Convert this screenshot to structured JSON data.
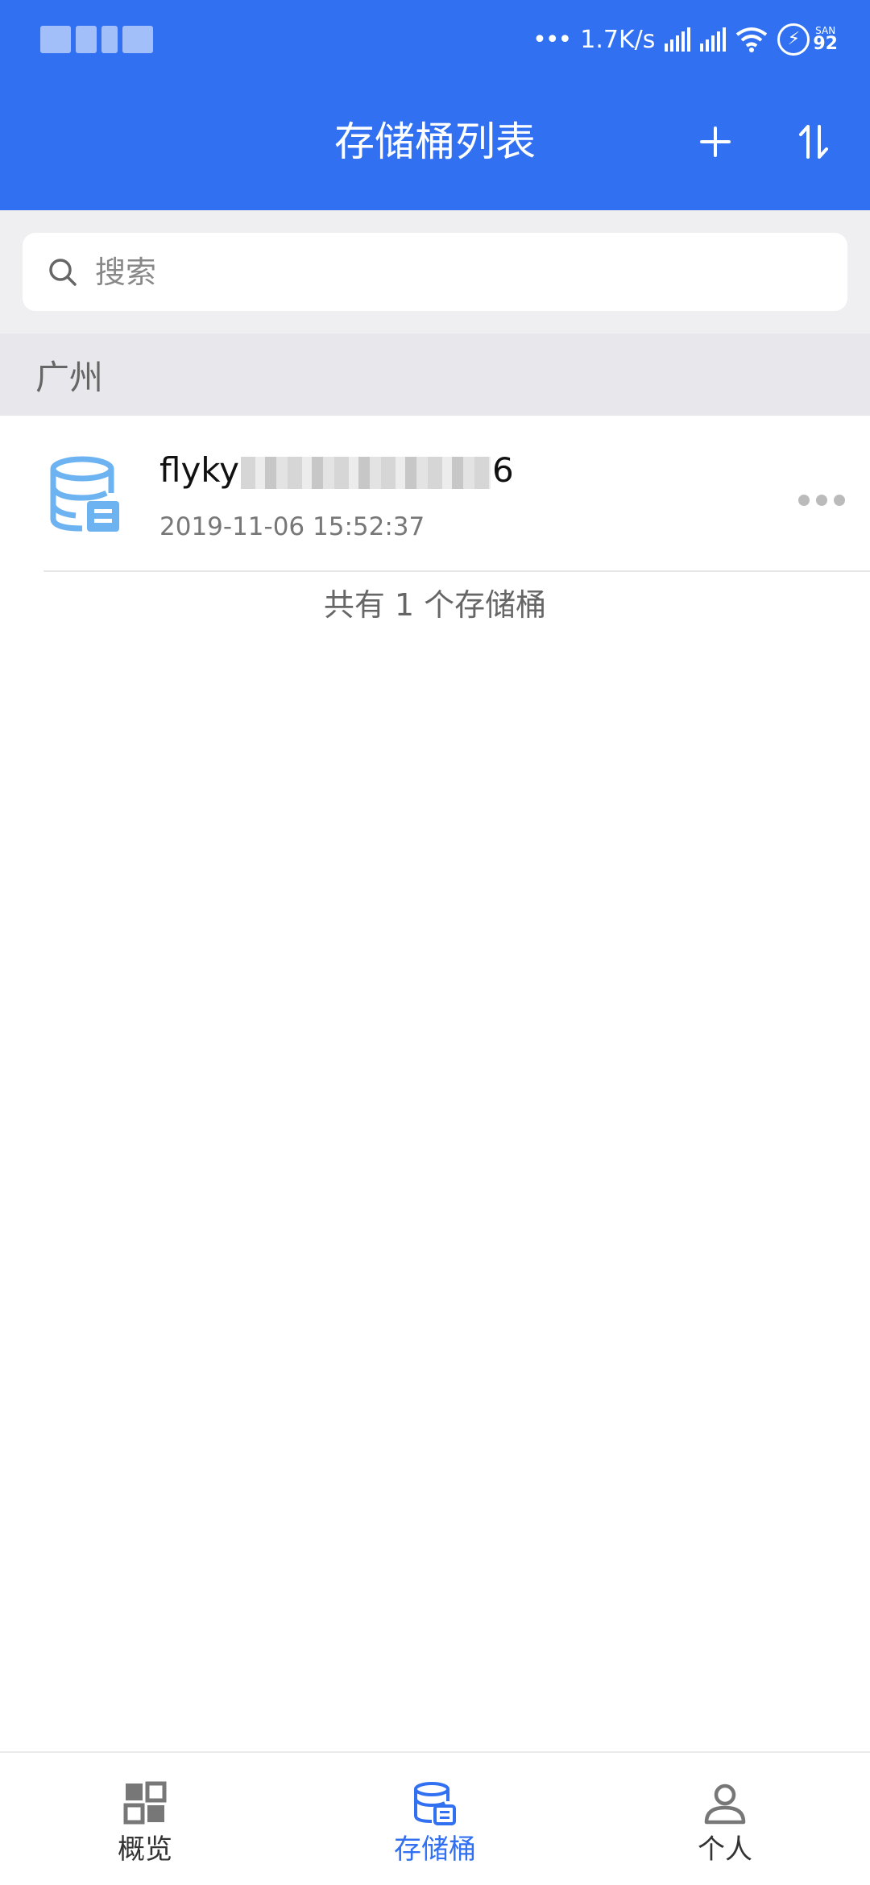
{
  "status_bar": {
    "network_speed": "1.7K/s",
    "battery_label": "SAN",
    "battery_level": "92"
  },
  "header": {
    "title": "存储桶列表",
    "add_icon": "plus-icon",
    "sort_icon": "sort-icon"
  },
  "search": {
    "placeholder": "搜索"
  },
  "region": {
    "name": "广州"
  },
  "buckets": [
    {
      "name_prefix": "flyky",
      "name_suffix": "6",
      "created": "2019-11-06 15:52:37"
    }
  ],
  "summary": {
    "count_text": "共有 1 个存储桶"
  },
  "nav": {
    "items": [
      {
        "label": "概览",
        "icon": "grid-icon",
        "active": false
      },
      {
        "label": "存储桶",
        "icon": "bucket-icon",
        "active": true
      },
      {
        "label": "个人",
        "icon": "person-icon",
        "active": false
      }
    ]
  },
  "colors": {
    "primary": "#3171F1",
    "bucket_icon": "#6DB3F2"
  }
}
